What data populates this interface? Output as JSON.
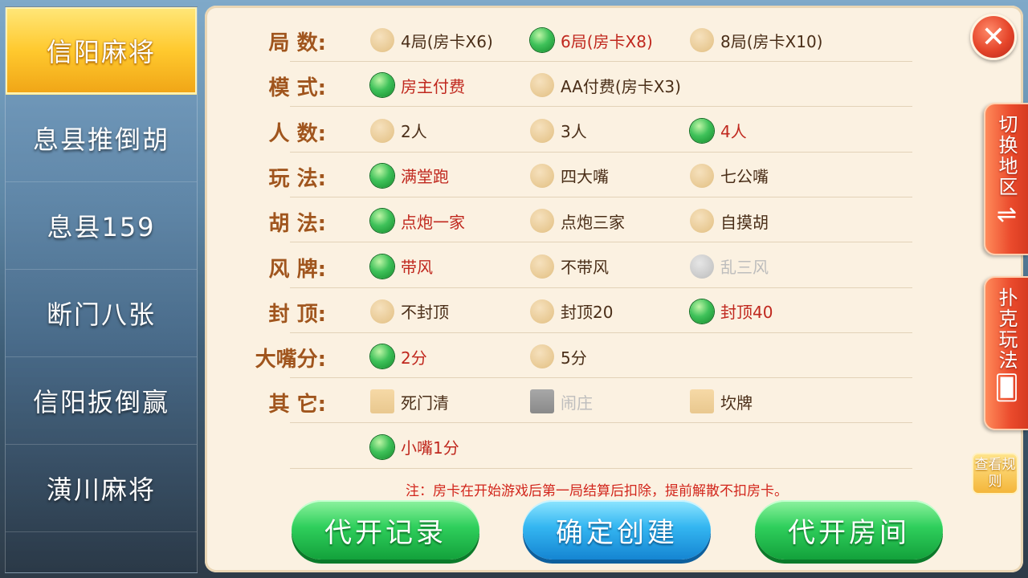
{
  "sidebar": {
    "items": [
      {
        "label": "信阳麻将",
        "active": true
      },
      {
        "label": "息县推倒胡",
        "active": false
      },
      {
        "label": "息县159",
        "active": false
      },
      {
        "label": "断门八张",
        "active": false
      },
      {
        "label": "信阳扳倒赢",
        "active": false
      },
      {
        "label": "潢川麻将",
        "active": false
      }
    ]
  },
  "rows": [
    {
      "label": "局 数:",
      "type": "radio",
      "options": [
        {
          "label": "4局(房卡X6)",
          "state": "off"
        },
        {
          "label": "6局(房卡X8)",
          "state": "on"
        },
        {
          "label": "8局(房卡X10)",
          "state": "off"
        }
      ]
    },
    {
      "label": "模 式:",
      "type": "radio",
      "options": [
        {
          "label": "房主付费",
          "state": "on"
        },
        {
          "label": "AA付费(房卡X3)",
          "state": "off"
        }
      ]
    },
    {
      "label": "人 数:",
      "type": "radio",
      "options": [
        {
          "label": "2人",
          "state": "off"
        },
        {
          "label": "3人",
          "state": "off"
        },
        {
          "label": "4人",
          "state": "on"
        }
      ]
    },
    {
      "label": "玩 法:",
      "type": "radio",
      "options": [
        {
          "label": "满堂跑",
          "state": "on"
        },
        {
          "label": "四大嘴",
          "state": "off"
        },
        {
          "label": "七公嘴",
          "state": "off"
        }
      ]
    },
    {
      "label": "胡 法:",
      "type": "radio",
      "options": [
        {
          "label": "点炮一家",
          "state": "on"
        },
        {
          "label": "点炮三家",
          "state": "off"
        },
        {
          "label": "自摸胡",
          "state": "off"
        }
      ]
    },
    {
      "label": "风 牌:",
      "type": "radio",
      "options": [
        {
          "label": "带风",
          "state": "on"
        },
        {
          "label": "不带风",
          "state": "off"
        },
        {
          "label": "乱三风",
          "state": "disabled"
        }
      ]
    },
    {
      "label": "封 顶:",
      "type": "radio",
      "options": [
        {
          "label": "不封顶",
          "state": "off"
        },
        {
          "label": "封顶20",
          "state": "off"
        },
        {
          "label": "封顶40",
          "state": "on"
        }
      ]
    },
    {
      "label": "大嘴分:",
      "type": "radio",
      "options": [
        {
          "label": "2分",
          "state": "on"
        },
        {
          "label": "5分",
          "state": "off"
        }
      ]
    },
    {
      "label": "其 它:",
      "type": "check",
      "options": [
        {
          "label": "死门清",
          "state": "off"
        },
        {
          "label": "闹庄",
          "state": "disabled"
        },
        {
          "label": "坎牌",
          "state": "off"
        }
      ]
    },
    {
      "label": "",
      "type": "radio",
      "options": [
        {
          "label": "小嘴1分",
          "state": "on"
        }
      ]
    }
  ],
  "note": "注：房卡在开始游戏后第一局结算后扣除，提前解散不扣房卡。",
  "buttons": {
    "proxy_record": "代开记录",
    "confirm_create": "确定创建",
    "proxy_room": "代开房间"
  },
  "close": "✕",
  "right_tabs": {
    "switch_region": "切换地区",
    "poker_rules": "扑克玩法",
    "view_rules": "查看规则"
  },
  "colors": {
    "panel_bg": "#fbf1e1",
    "label_brown": "#a0551e",
    "selected_red": "#c0281e",
    "radio_green": "#3fc25a",
    "button_green": "#2fcf5c",
    "button_blue": "#34b6f1",
    "tab_red": "#ea4a2c"
  }
}
